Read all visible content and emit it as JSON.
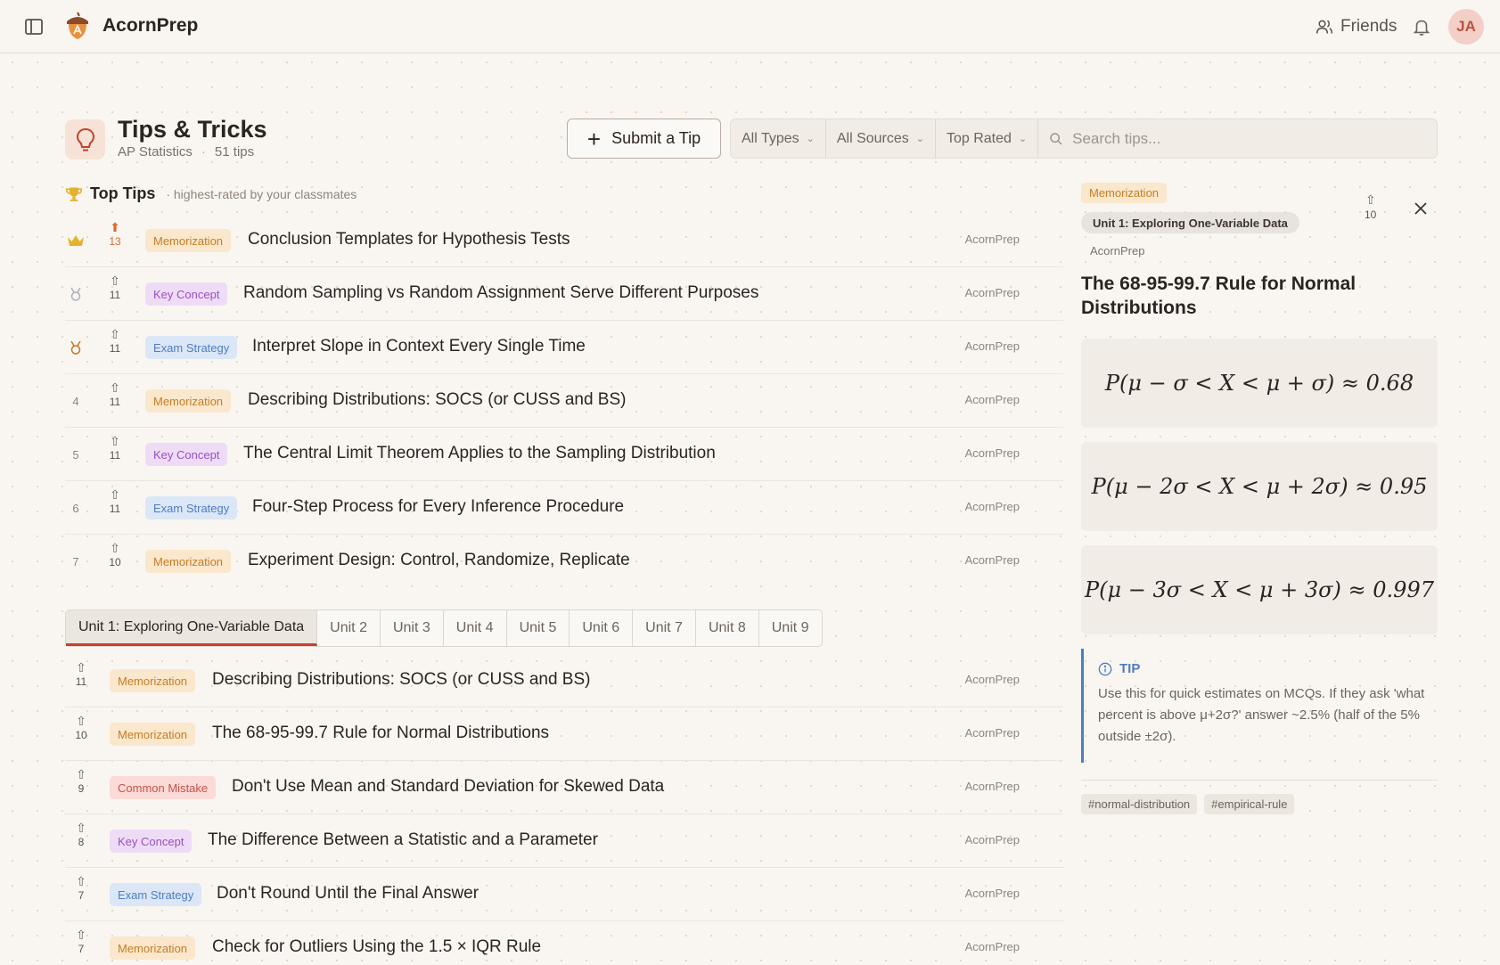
{
  "app": {
    "name": "AcornPrep"
  },
  "topbar": {
    "friends_label": "Friends",
    "avatar_initials": "JA"
  },
  "header": {
    "title": "Tips & Tricks",
    "course": "AP Statistics",
    "tip_count": "51 tips",
    "submit_label": "Submit a Tip",
    "filters": [
      "All Types",
      "All Sources",
      "Top Rated"
    ],
    "search_placeholder": "Search tips..."
  },
  "top_tips": {
    "title": "Top Tips",
    "subtitle": "· highest-rated by your classmates",
    "items": [
      {
        "rank": "",
        "votes": "13",
        "category": "Memorization",
        "title": "Conclusion Templates for Hypothesis Tests",
        "author": "AcornPrep"
      },
      {
        "rank": "",
        "votes": "11",
        "category": "Key Concept",
        "title": "Random Sampling vs Random Assignment Serve Different Purposes",
        "author": "AcornPrep"
      },
      {
        "rank": "",
        "votes": "11",
        "category": "Exam Strategy",
        "title": "Interpret Slope in Context Every Single Time",
        "author": "AcornPrep"
      },
      {
        "rank": "4",
        "votes": "11",
        "category": "Memorization",
        "title": "Describing Distributions: SOCS (or CUSS and BS)",
        "author": "AcornPrep"
      },
      {
        "rank": "5",
        "votes": "11",
        "category": "Key Concept",
        "title": "The Central Limit Theorem Applies to the Sampling Distribution",
        "author": "AcornPrep"
      },
      {
        "rank": "6",
        "votes": "11",
        "category": "Exam Strategy",
        "title": "Four-Step Process for Every Inference Procedure",
        "author": "AcornPrep"
      },
      {
        "rank": "7",
        "votes": "10",
        "category": "Memorization",
        "title": "Experiment Design: Control, Randomize, Replicate",
        "author": "AcornPrep"
      }
    ]
  },
  "unit_tabs": [
    "Unit 1: Exploring One-Variable Data",
    "Unit 2",
    "Unit 3",
    "Unit 4",
    "Unit 5",
    "Unit 6",
    "Unit 7",
    "Unit 8",
    "Unit 9"
  ],
  "unit_tips": [
    {
      "votes": "11",
      "category": "Memorization",
      "title": "Describing Distributions: SOCS (or CUSS and BS)",
      "author": "AcornPrep"
    },
    {
      "votes": "10",
      "category": "Memorization",
      "title": "The 68-95-99.7 Rule for Normal Distributions",
      "author": "AcornPrep"
    },
    {
      "votes": "9",
      "category": "Common Mistake",
      "title": "Don't Use Mean and Standard Deviation for Skewed Data",
      "author": "AcornPrep"
    },
    {
      "votes": "8",
      "category": "Key Concept",
      "title": "The Difference Between a Statistic and a Parameter",
      "author": "AcornPrep"
    },
    {
      "votes": "7",
      "category": "Exam Strategy",
      "title": "Don't Round Until the Final Answer",
      "author": "AcornPrep"
    },
    {
      "votes": "7",
      "category": "Memorization",
      "title": "Check for Outliers Using the 1.5 × IQR Rule",
      "author": "AcornPrep"
    }
  ],
  "detail": {
    "category": "Memorization",
    "unit": "Unit 1: Exploring One-Variable Data",
    "author": "AcornPrep",
    "votes": "10",
    "title": "The 68-95-99.7 Rule for Normal Distributions",
    "formulas": [
      "P(μ − σ < X < μ + σ) ≈ 0.68",
      "P(μ − 2σ < X < μ + 2σ) ≈ 0.95",
      "P(μ − 3σ < X < μ + 3σ) ≈ 0.997"
    ],
    "callout_label": "TIP",
    "callout_text": "Use this for quick estimates on MCQs. If they ask 'what percent is above μ+2σ?' answer ~2.5% (half of the 5% outside ±2σ).",
    "tags": [
      "#normal-distribution",
      "#empirical-rule"
    ]
  },
  "colors": {
    "accent": "#c4412f",
    "memorization": "#c57d26",
    "key_concept": "#9a50c2",
    "exam_strategy": "#4e7cc4",
    "common_mistake": "#c75148"
  }
}
